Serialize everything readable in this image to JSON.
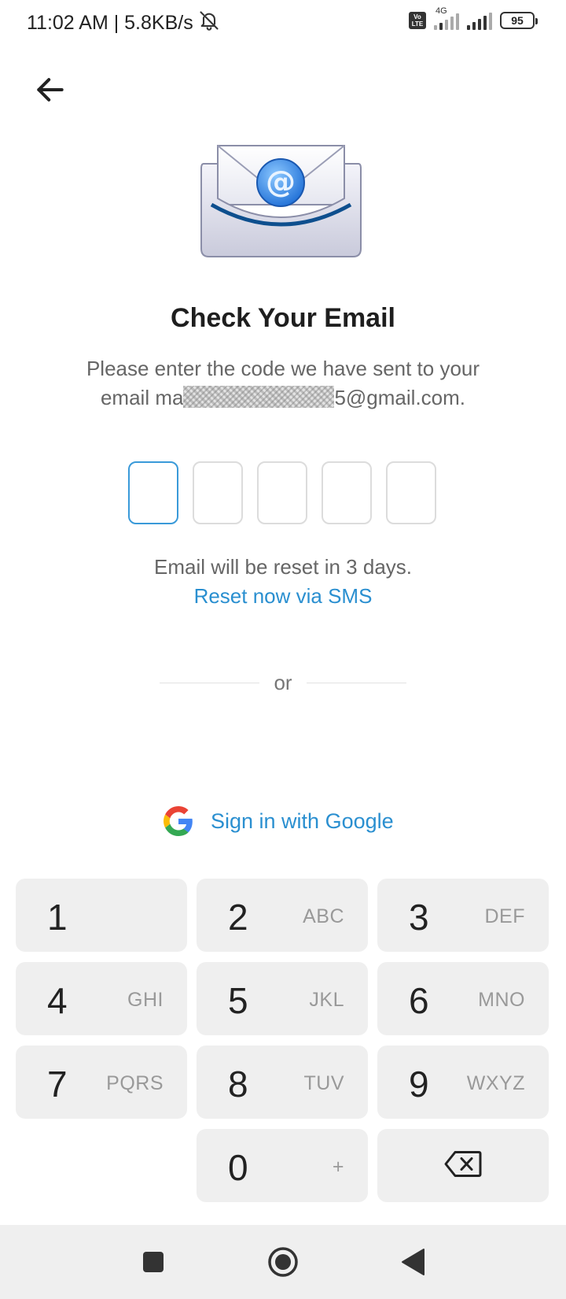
{
  "status_bar": {
    "time_speed": "11:02 AM | 5.8KB/s",
    "network_type": "4G",
    "volte_line1": "Vo",
    "volte_line2": "LTE",
    "battery": "95"
  },
  "header": {
    "title": "Check Your Email",
    "subtitle_line1": "Please enter the code we have sent to your",
    "email_prefix": "email ma",
    "email_suffix": "5@gmail.com."
  },
  "code_input": {
    "boxes": [
      "",
      "",
      "",
      "",
      ""
    ]
  },
  "reset": {
    "note": "Email will be reset in 3 days.",
    "link": "Reset now via SMS"
  },
  "divider": {
    "label": "or"
  },
  "google": {
    "label": "Sign in with Google"
  },
  "keypad": {
    "keys": [
      {
        "num": "1",
        "letters": ""
      },
      {
        "num": "2",
        "letters": "ABC"
      },
      {
        "num": "3",
        "letters": "DEF"
      },
      {
        "num": "4",
        "letters": "GHI"
      },
      {
        "num": "5",
        "letters": "JKL"
      },
      {
        "num": "6",
        "letters": "MNO"
      },
      {
        "num": "7",
        "letters": "PQRS"
      },
      {
        "num": "8",
        "letters": "TUV"
      },
      {
        "num": "9",
        "letters": "WXYZ"
      },
      {
        "num": "0",
        "letters": "+"
      }
    ]
  },
  "icons": {
    "back": "arrow-left-icon",
    "mute": "bell-off-icon",
    "delete": "backspace-icon",
    "google": "google-g-icon",
    "envelope": "email-envelope-icon"
  },
  "colors": {
    "accent": "#2a8fd0",
    "active_box": "#3a9ad9",
    "key_bg": "#efefef"
  }
}
